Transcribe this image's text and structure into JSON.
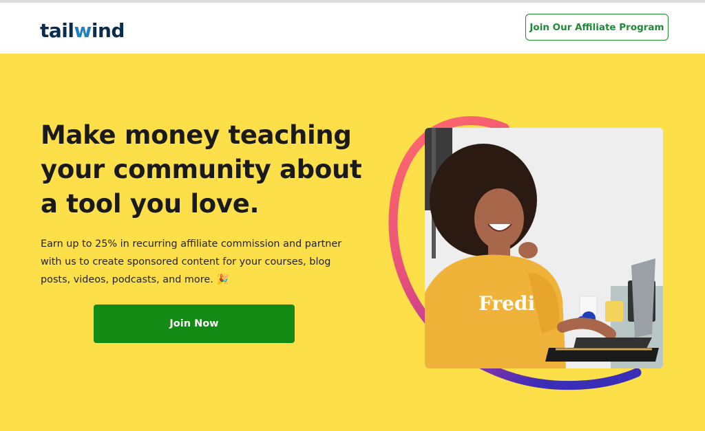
{
  "brand": {
    "logo_prefix": "tail",
    "logo_w": "w",
    "logo_suffix": "ind"
  },
  "header": {
    "affiliate_button": "Join Our Affiliate Program"
  },
  "hero": {
    "headline": "Make money teaching your community about a tool you love.",
    "subtext": "Earn up to 25% in recurring affiliate commission and partner with us to create sponsored content for your courses, blog posts, videos, podcasts, and more. 🎉",
    "cta": "Join Now"
  },
  "colors": {
    "hero_bg": "#fddf4a",
    "primary_green": "#138a13",
    "brand_navy": "#0a2b4d",
    "brand_blue": "#1f7fc4",
    "ring_start": "#ff6b6b",
    "ring_mid": "#c13aa8",
    "ring_end": "#3a2db8"
  },
  "photo": {
    "sweatshirt_text": "Fredi"
  }
}
